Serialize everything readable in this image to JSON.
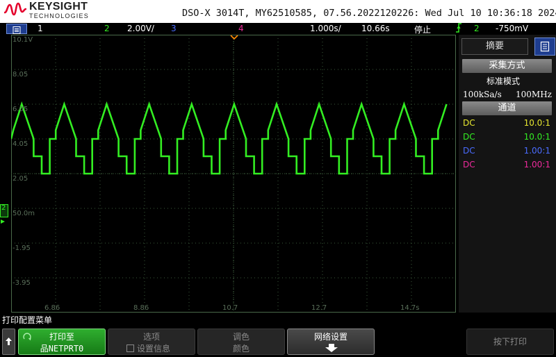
{
  "header": {
    "brand": "KEYSIGHT",
    "brand_sub": "TECHNOLOGIES",
    "scope_info": "DSO-X 3014T, MY62510585, 07.56.2022120226: Wed Jul 10 10:36:18 2024"
  },
  "status_bar": {
    "ch1_label": "1",
    "ch2_label": "2",
    "ch2_scale": "2.00V/",
    "ch3_label": "3",
    "ch4_label": "4",
    "timebase": "1.000s/",
    "delay": "10.66s",
    "run_state": "停止",
    "trigger_channel": "2",
    "trigger_level": "-750mV"
  },
  "grid": {
    "y_labels": [
      "10.1V",
      "8.05",
      "6.05",
      "4.05",
      "2.05",
      "50.0m",
      "-1.95",
      "-3.95"
    ],
    "x_labels": [
      "6.86",
      "8.86",
      "10.7",
      "12.7",
      "14.7s"
    ],
    "ch2_marker": "2"
  },
  "trace": {
    "color": "#33ee22",
    "period_divs": 0.955,
    "levels_volts": {
      "peak": 4.05,
      "ramp_start": 2.55,
      "top_step": 2.05,
      "middle_step": 1.05,
      "low_step": 0.05
    }
  },
  "right_panel": {
    "tab_summary": "摘要",
    "acq_header": "采集方式",
    "acq_mode": "标准模式",
    "sample_rate": "100kSa/s",
    "bandwidth": "100MHz",
    "channels_header": "通道",
    "channels": [
      {
        "coupling": "DC",
        "ratio": "10.0:1",
        "color": "#e8e830"
      },
      {
        "coupling": "DC",
        "ratio": "10.0:1",
        "color": "#33ee22"
      },
      {
        "coupling": "DC",
        "ratio": "1.00:1",
        "color": "#4a6cff"
      },
      {
        "coupling": "DC",
        "ratio": "1.00:1",
        "color": "#ee2a9c"
      }
    ]
  },
  "colors": {
    "ch1": "#e8e830",
    "ch2": "#33ee22",
    "ch3": "#4a6cff",
    "ch4": "#ee2a9c",
    "brand_red": "#e4002b"
  },
  "softkeys": {
    "menu_title": "打印配置菜单",
    "print_to_label": "打印至",
    "print_to_value": "品NETPRT0",
    "options_label": "选项",
    "options_value": "设置信息",
    "palette_label": "调色",
    "palette_value": "颜色",
    "network_label": "网络设置",
    "press_to_print": "按下打印"
  }
}
